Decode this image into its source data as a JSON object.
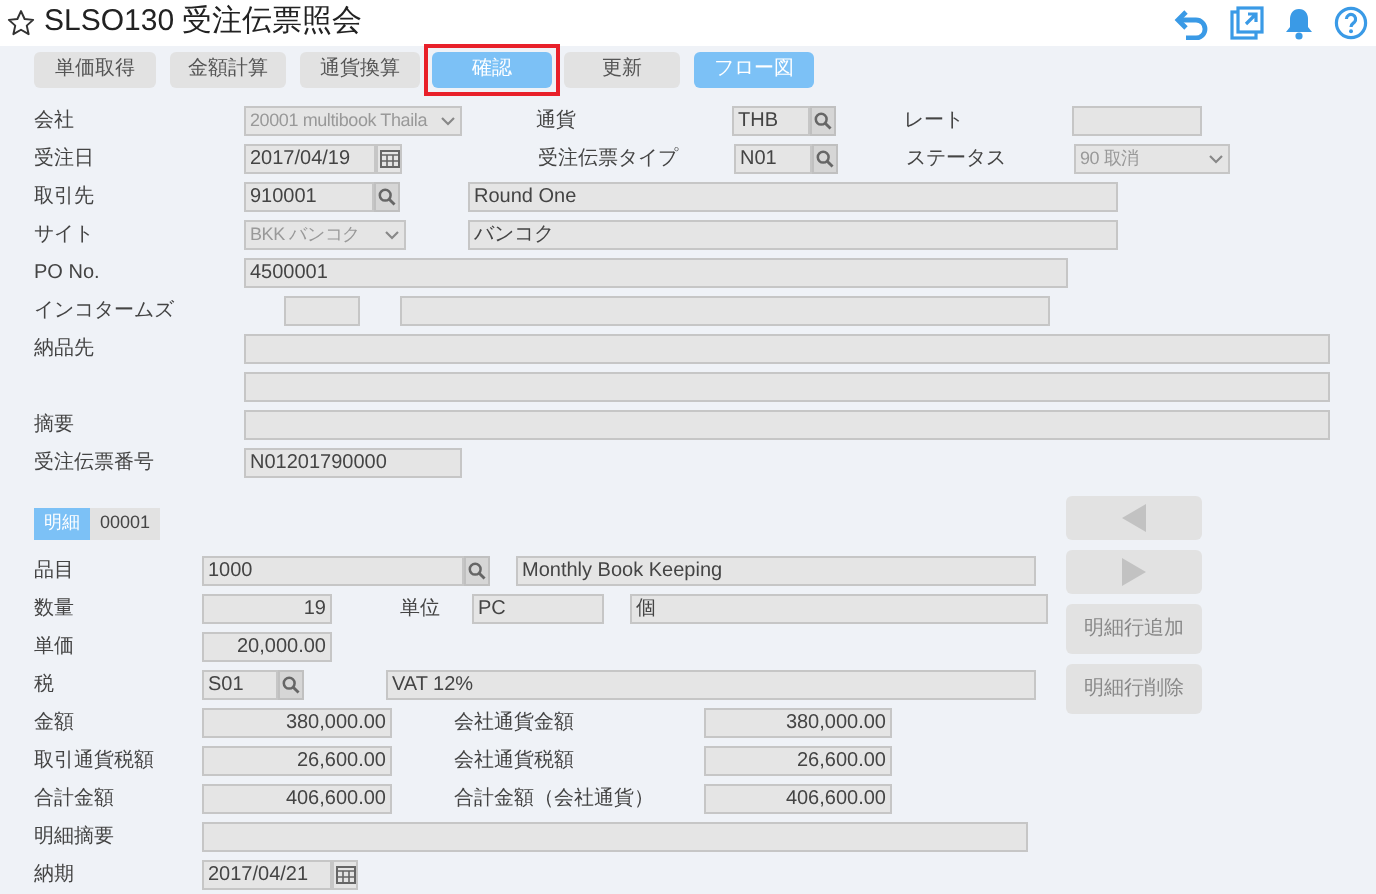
{
  "header": {
    "title": "SLSO130 受注伝票照会"
  },
  "toolbar": [
    {
      "label": "単価取得",
      "kind": "secondary",
      "highlighted": false
    },
    {
      "label": "金額計算",
      "kind": "secondary",
      "highlighted": false
    },
    {
      "label": "通貨換算",
      "kind": "secondary",
      "highlighted": false
    },
    {
      "label": "確認",
      "kind": "primary",
      "highlighted": true
    },
    {
      "label": "更新",
      "kind": "secondary",
      "highlighted": false
    },
    {
      "label": "フロー図",
      "kind": "primary",
      "highlighted": false
    }
  ],
  "order": {
    "company": {
      "label": "会社",
      "value": "20001 multibook Thaila"
    },
    "currency": {
      "label": "通貨",
      "value": "THB"
    },
    "rate": {
      "label": "レート"
    },
    "order_date": {
      "label": "受注日",
      "value": "2017/04/19"
    },
    "order_type": {
      "label": "受注伝票タイプ",
      "value": "N01"
    },
    "status": {
      "label": "ステータス",
      "value": "90 取消"
    },
    "customer": {
      "label": "取引先",
      "code": "910001",
      "name": "Round One"
    },
    "site": {
      "label": "サイト",
      "code": "BKK バンコク",
      "name": "バンコク"
    },
    "po_no": {
      "label": "PO No.",
      "value": "4500001"
    },
    "incoterms": {
      "label": "インコタームズ"
    },
    "ship_to": {
      "label": "納品先"
    },
    "memo": {
      "label": "摘要"
    },
    "order_number": {
      "label": "受注伝票番号",
      "value": "N01201790000"
    }
  },
  "line": {
    "tabs": [
      {
        "label": "明細",
        "selected": true
      },
      {
        "label": "00001",
        "selected": false
      }
    ],
    "item": {
      "label": "品目",
      "code": "1000",
      "name": "Monthly Book Keeping"
    },
    "quantity": {
      "label": "数量",
      "value": "19"
    },
    "unit": {
      "label": "単位",
      "code": "PC",
      "name": "個"
    },
    "unit_price": {
      "label": "単価",
      "value": "20,000.00"
    },
    "tax": {
      "label": "税",
      "code": "S01",
      "name": "VAT 12%"
    },
    "amount": {
      "label": "金額",
      "value": "380,000.00"
    },
    "company_amount": {
      "label": "会社通貨金額",
      "value": "380,000.00"
    },
    "tax_amount": {
      "label": "取引通貨税額",
      "value": "26,600.00"
    },
    "company_tax_amount": {
      "label": "会社通貨税額",
      "value": "26,600.00"
    },
    "total": {
      "label": "合計金額",
      "value": "406,600.00"
    },
    "company_total": {
      "label": "合計金額（会社通貨）",
      "value": "406,600.00"
    },
    "line_memo": {
      "label": "明細摘要"
    },
    "delivery_date": {
      "label": "納期",
      "value": "2017/04/21"
    }
  },
  "side_buttons": [
    {
      "kind": "prev"
    },
    {
      "kind": "next"
    },
    {
      "kind": "text",
      "label": "明細行追加"
    },
    {
      "kind": "text",
      "label": "明細行削除"
    }
  ]
}
